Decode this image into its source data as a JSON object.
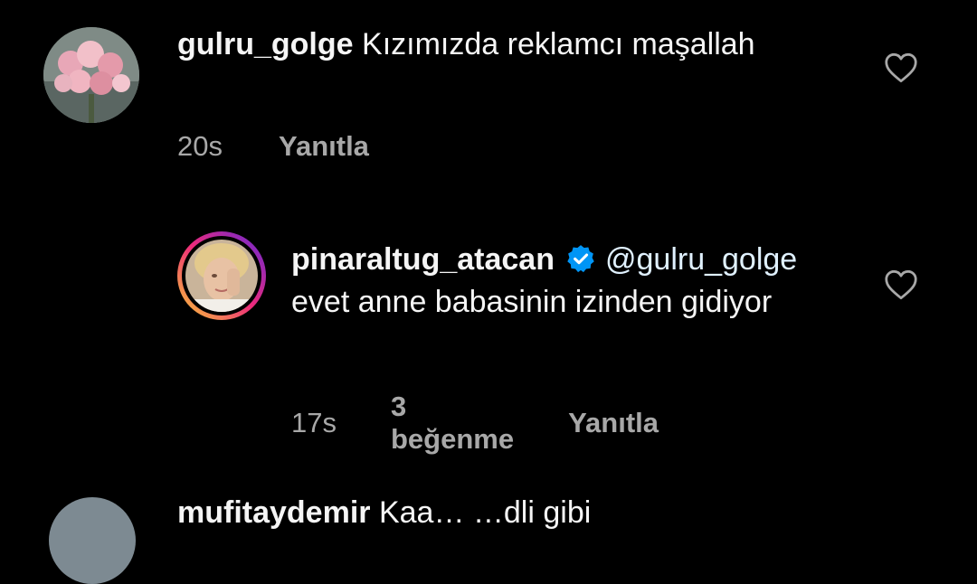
{
  "colors": {
    "background": "#000000",
    "text": "#f5f5f5",
    "meta": "#a8a8a8",
    "verified": "#0095f6",
    "story_ring_start": "#f9ce34",
    "story_ring_end": "#ee2a7b"
  },
  "comments": [
    {
      "username": "gulru_golge",
      "text": "Kızımızda reklamcı maşallah",
      "time": "20s",
      "reply_label": "Yanıtla",
      "avatar_icon": "flower-bouquet-avatar",
      "like_icon": "heart-outline-icon"
    },
    {
      "username": "pinaraltug_atacan",
      "verified": true,
      "mention": "@gulru_golge",
      "text": "evet anne babasinin izinden gidiyor",
      "time": "17s",
      "likes_label": "3 beğenme",
      "reply_label": "Yanıtla",
      "avatar_icon": "profile-photo-avatar",
      "like_icon": "heart-outline-icon",
      "verified_icon": "verified-badge-icon"
    },
    {
      "username": "mufitaydemir",
      "text": "Kaa… …dli gibi",
      "avatar_icon": "profile-photo-avatar"
    }
  ]
}
